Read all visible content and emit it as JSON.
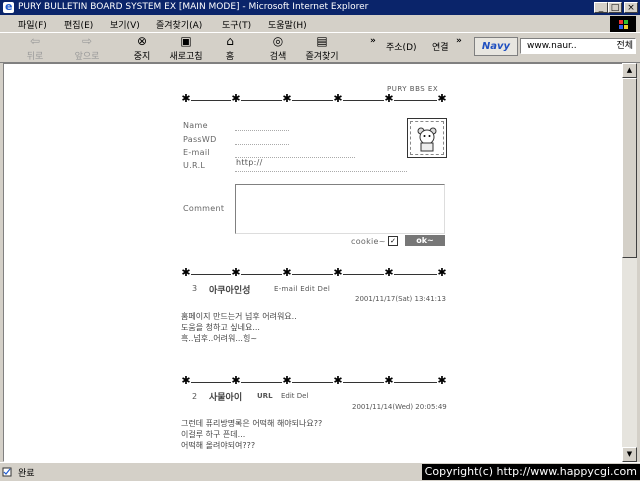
{
  "window": {
    "title": "PURY BULLETIN BOARD SYSTEM EX [MAIN MODE] - Microsoft Internet Explorer",
    "btn_min": "_",
    "btn_max": "□",
    "btn_close": "×"
  },
  "menu": {
    "file": "파일(F)",
    "edit": "편집(E)",
    "view": "보기(V)",
    "favorites": "즐겨찾기(A)",
    "tools": "도구(T)",
    "help": "도움말(H)"
  },
  "toolbar": {
    "back": "뒤로",
    "forward": "앞으로",
    "stop": "중지",
    "refresh": "새로고침",
    "home": "홈",
    "search": "검색",
    "favorites": "즐겨찾기",
    "more": "»",
    "address_label": "주소(D)",
    "go_label": "연결",
    "navy_logo": "Navy",
    "url_value": "www.naur..",
    "url_scope": "전체"
  },
  "bbs": {
    "brand": "PURY BBS EX",
    "form": {
      "name_label": "Name",
      "pass_label": "PassWD",
      "email_label": "E-mail",
      "url_label": "U.R.L",
      "url_value": "http://",
      "comment_label": "Comment",
      "cookie_label": "cookie~",
      "ok_label": "ok~"
    },
    "posts": [
      {
        "number": "3",
        "author": "아쿠아인성",
        "links": "E-mail Edit Del",
        "date": "2001/11/17(Sat) 13:41:13",
        "lines": [
          "홈페이지 만드는거 넘후 어려워요..",
          "도움을 청하고 싶네요...",
          "흑..넘후..어려워...힝~"
        ]
      },
      {
        "number": "2",
        "author": "사물아이",
        "links_bold": "URL",
        "links": "Edit Del",
        "date": "2001/11/14(Wed) 20:05:49",
        "lines": [
          "그런데 퓨리방명록은 어떡해 해야되나요??",
          "이걸루 하구 픈데...",
          "어떡해 올려야되여???"
        ]
      }
    ]
  },
  "status": {
    "text": "완료",
    "copyright": "Copyright(c) http://www.happycgi.com"
  },
  "colors": {
    "titlebar": "#0a246a",
    "chrome": "#d4d0c8",
    "ok_button": "#777777"
  },
  "icons": {
    "back": "back-arrow-icon",
    "forward": "forward-arrow-icon",
    "stop": "stop-icon",
    "refresh": "refresh-icon",
    "home": "home-icon",
    "search": "search-icon",
    "favorites": "favorites-icon"
  }
}
